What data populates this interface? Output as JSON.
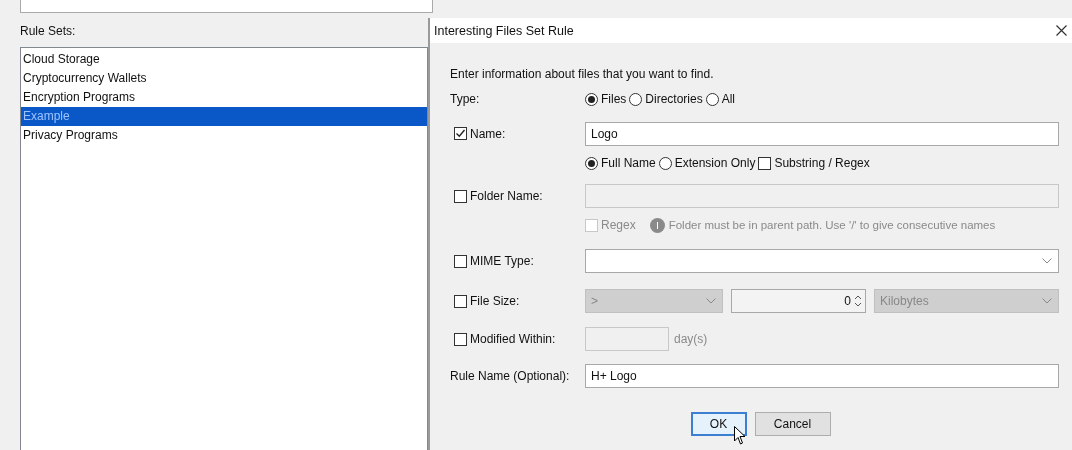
{
  "rule_sets": {
    "label": "Rule Sets:",
    "items": [
      {
        "label": "Cloud Storage",
        "selected": false
      },
      {
        "label": "Cryptocurrency Wallets",
        "selected": false
      },
      {
        "label": "Encryption Programs",
        "selected": false
      },
      {
        "label": "Example",
        "selected": true
      },
      {
        "label": "Privacy Programs",
        "selected": false
      }
    ]
  },
  "dialog": {
    "title": "Interesting Files Set Rule",
    "intro": "Enter information about files that you want to find.",
    "type": {
      "label": "Type:",
      "options": [
        {
          "label": "Files",
          "selected": true
        },
        {
          "label": "Directories",
          "selected": false
        },
        {
          "label": "All",
          "selected": false
        }
      ]
    },
    "name": {
      "label": "Name:",
      "checked": true,
      "value": "Logo",
      "match_options": [
        {
          "kind": "radio",
          "label": "Full Name",
          "selected": true
        },
        {
          "kind": "radio",
          "label": "Extension Only",
          "selected": false
        },
        {
          "kind": "checkbox",
          "label": "Substring / Regex",
          "checked": false
        }
      ]
    },
    "folder_name": {
      "label": "Folder Name:",
      "checked": false,
      "disabled": true,
      "regex": {
        "label": "Regex",
        "checked": false
      },
      "hint": "Folder must be in parent path. Use '/' to give consecutive names"
    },
    "mime_type": {
      "label": "MIME Type:",
      "checked": false
    },
    "file_size": {
      "label": "File Size:",
      "checked": false,
      "disabled": true,
      "operator": ">",
      "value": "0",
      "unit": "Kilobytes"
    },
    "modified_within": {
      "label": "Modified Within:",
      "checked": false,
      "disabled": true,
      "unit": "day(s)"
    },
    "rule_name": {
      "label": "Rule Name (Optional):",
      "value": "H+ Logo"
    },
    "buttons": [
      {
        "label": "OK",
        "focused": true
      },
      {
        "label": "Cancel",
        "focused": false
      }
    ]
  }
}
